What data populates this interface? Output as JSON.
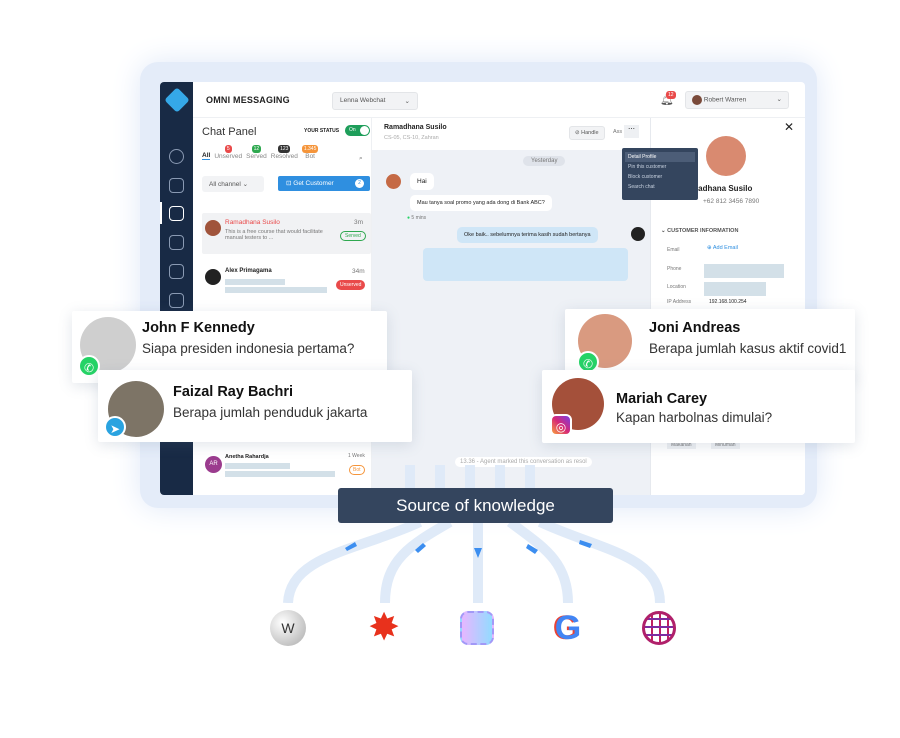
{
  "app": {
    "title": "OMNI MESSAGING",
    "channel_select": "Lenna Webchat",
    "notification_count": "12",
    "user": "Robert Warren"
  },
  "chat_panel": {
    "title": "Chat Panel",
    "status_label": "YOUR STATUS",
    "status_toggle": "On",
    "tabs": [
      {
        "label": "All",
        "count": ""
      },
      {
        "label": "Unserved",
        "count": "5"
      },
      {
        "label": "Served",
        "count": "12"
      },
      {
        "label": "Resolved",
        "count": "123"
      },
      {
        "label": "Bot",
        "count": "1.345"
      }
    ],
    "channel_filter": "All channel",
    "get_customer": "Get Customer",
    "get_customer_count": "2",
    "list": [
      {
        "name": "Ramadhana Susilo",
        "time": "3m",
        "preview": "This is a free course that would facilitate manual testers to ...",
        "status": "Served"
      },
      {
        "name": "Alex Primagama",
        "time": "34m",
        "status": "Unserved"
      },
      {
        "name": "Anetha Rahardja",
        "initials": "AR",
        "time": "1 Week",
        "status": "Bot"
      }
    ]
  },
  "conversation": {
    "name": "Ramadhana Susilo",
    "sub": "CS-05, CS-10, Zahran",
    "handle": "Handle",
    "assign": "Ass",
    "date": "Yesterday",
    "messages": [
      {
        "from": "customer",
        "text": "Hai"
      },
      {
        "from": "customer",
        "text": "Mau tanya soal promo yang ada dong di Bank ABC?"
      },
      {
        "from": "agent",
        "text": "Oke baik.. sebelumnya terima kasih sudah bertanya"
      }
    ],
    "msg_time": "5 mins",
    "system_note": "13.36 - Agent marked this conversation as resol",
    "menu": [
      "Detail Profile",
      "Pin this customer",
      "Block customer",
      "Search chat"
    ]
  },
  "profile": {
    "name": "madhana Susilo",
    "phone": "+62 812 3456 7890",
    "section": "CUSTOMER INFORMATION",
    "fields": {
      "email_label": "Email",
      "add_email": "Add Email",
      "phone_label": "Phone",
      "location_label": "Location",
      "ip_label": "IP Address",
      "ip": "192.168.100.254"
    },
    "tags": [
      "Makanan",
      "Minuman"
    ]
  },
  "cards": [
    {
      "name": "John F Kennedy",
      "message": "Siapa presiden indonesia pertama?",
      "channel": "whatsapp"
    },
    {
      "name": "Faizal Ray Bachri",
      "message": "Berapa jumlah penduduk jakarta",
      "channel": "telegram"
    },
    {
      "name": "Joni Andreas",
      "message": "Berapa jumlah kasus aktif covid1",
      "channel": "whatsapp"
    },
    {
      "name": "Mariah Carey",
      "message": "Kapan harbolnas dimulai?",
      "channel": "instagram"
    }
  ],
  "knowledge": {
    "label": "Source of knowledge",
    "sources": [
      "wikipedia-icon",
      "wolfram-alpha-icon",
      "ai-brain-icon",
      "google-icon",
      "web-globe-icon"
    ]
  },
  "colors": {
    "navy": "#182a45",
    "accent": "#2f8fe0",
    "whatsapp": "#25d366",
    "telegram": "#2aa3e0",
    "unserved": "#e94a4a",
    "served": "#3cb371"
  }
}
